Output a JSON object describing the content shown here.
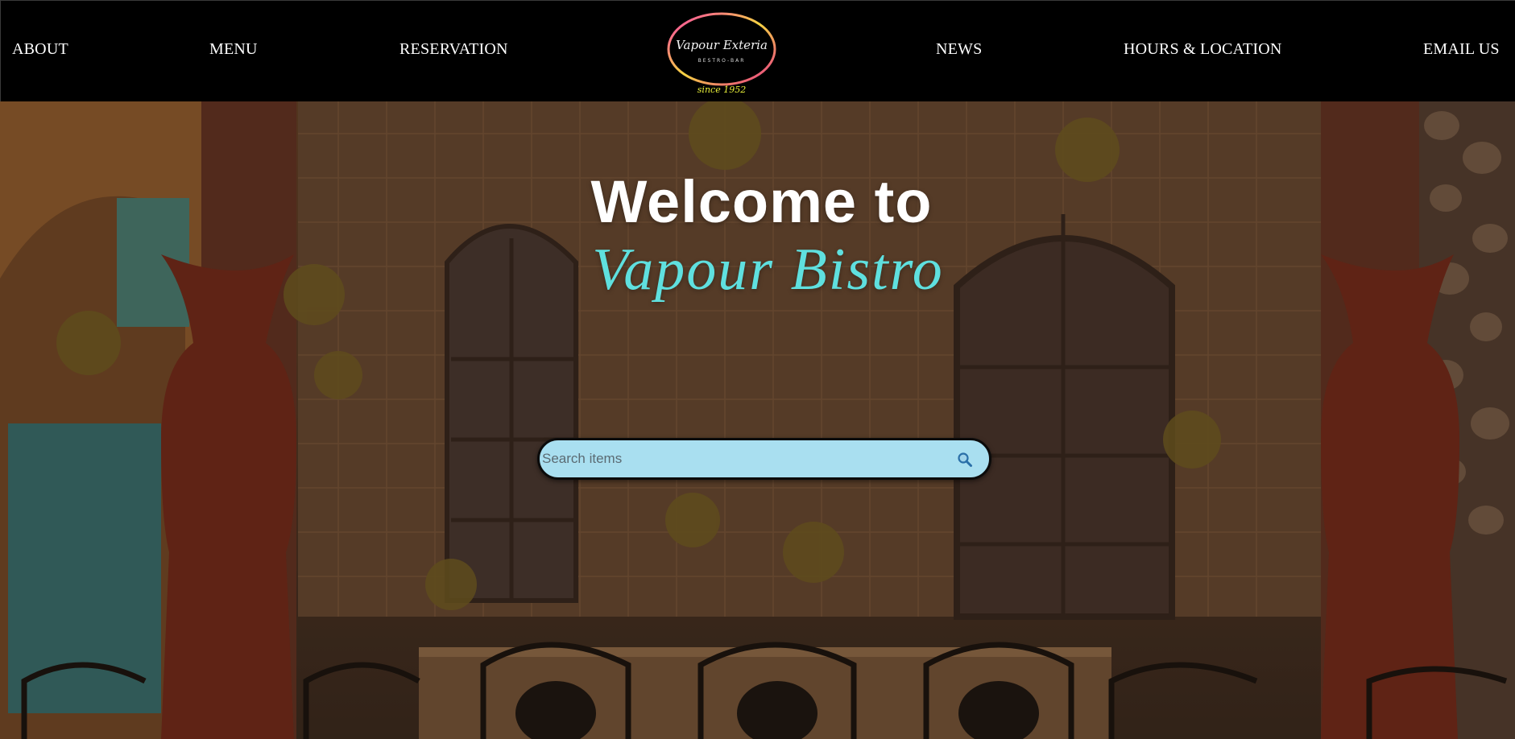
{
  "nav": {
    "links": [
      "ABOUT",
      "MENU",
      "RESERVATION",
      "NEWS",
      "HOURS & LOCATION",
      "EMAIL US"
    ],
    "logo": {
      "script_text": "Vapour Exteria",
      "subtitle": "BESTRO-BAR",
      "tagline": "since 1952"
    }
  },
  "hero": {
    "welcome": "Welcome to",
    "brand": "Vapour Bistro"
  },
  "search": {
    "placeholder": "Search items",
    "value": "",
    "icon": "search-icon"
  },
  "colors": {
    "navbar_bg": "#000000",
    "brand_accent": "#5fe0df",
    "search_bg": "#a9dff0"
  }
}
